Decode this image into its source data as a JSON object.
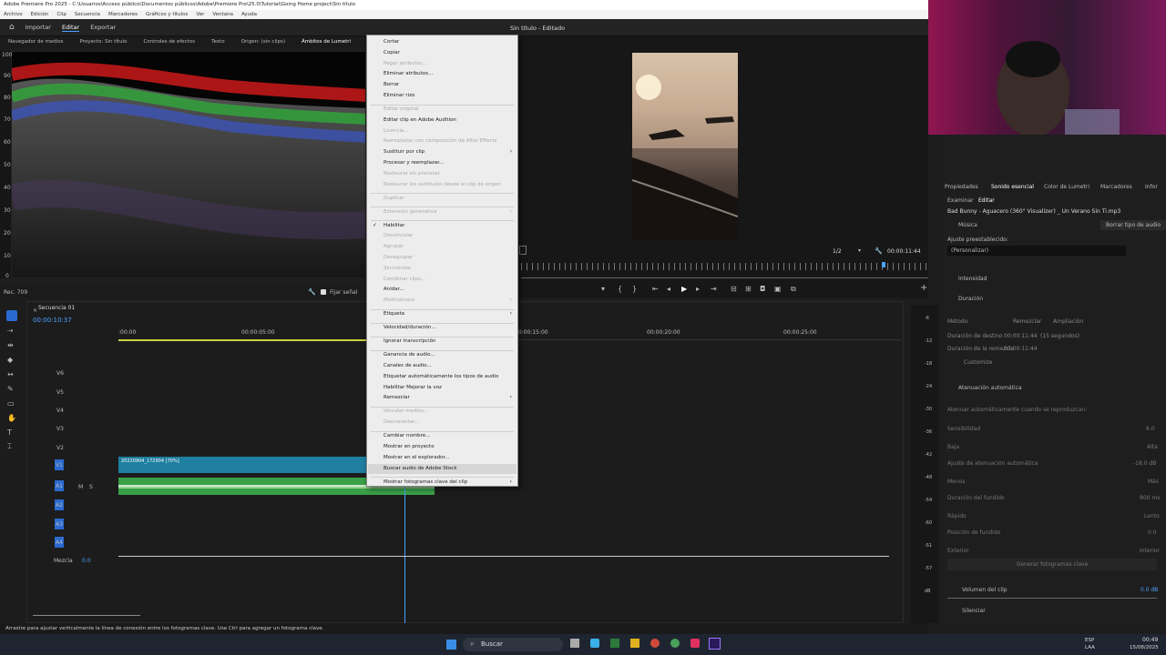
{
  "window": {
    "title": "Adobe Premiere Pro 2025 - C:\\Usuarios\\Acceso público\\Documentos públicos\\Adobe\\Premiere Pro\\25.0\\Tutorial\\Going Home project\\Sin título"
  },
  "menubar": [
    "Archivo",
    "Edición",
    "Clip",
    "Secuencia",
    "Marcadores",
    "Gráficos y títulos",
    "Ver",
    "Ventana",
    "Ayuda"
  ],
  "header": {
    "nav": [
      "Importar",
      "Editar",
      "Exportar"
    ],
    "title": "Sin título - Editado"
  },
  "panel_tabs": [
    "Navegador de medios",
    "Proyecto: Sin título",
    "Controles de efectos",
    "Texto",
    "Origen: (sin clips)",
    "Ámbitos de Lumetri"
  ],
  "scope": {
    "ticks": [
      "100",
      "90",
      "80",
      "70",
      "60",
      "50",
      "40",
      "30",
      "20",
      "10",
      "0"
    ],
    "rec": "Rec. 709",
    "fijar": "Fijar señal"
  },
  "program": {
    "fraction": "1/2",
    "timecode": "00:00:11:44"
  },
  "timeline": {
    "tab": "Secuencia 01",
    "timecode": "00:00:10:37",
    "ruler": [
      ":00:00",
      "00:00:05:00",
      "00:00:15:00",
      "00:00:20:00",
      "00:00:25:00"
    ],
    "video_tracks": [
      "V6",
      "V5",
      "V4",
      "V3",
      "V2",
      "V1"
    ],
    "audio_tracks": [
      "A1",
      "A2",
      "A3",
      "A4"
    ],
    "clip_label": "20220904_172904 [70%]",
    "mix_label": "Mezcla",
    "mix_value": "0.0",
    "track_btns": [
      "M",
      "S"
    ]
  },
  "meter_ticks": [
    "-6",
    "-12",
    "-18",
    "-24",
    "-30",
    "-36",
    "-42",
    "-48",
    "-54",
    "-60",
    "-51",
    "-57",
    "dB"
  ],
  "context_menu": [
    {
      "label": "Cortar",
      "enabled": true
    },
    {
      "label": "Copiar",
      "enabled": true
    },
    {
      "label": "Pegar atributos...",
      "enabled": false
    },
    {
      "label": "Eliminar atributos...",
      "enabled": true
    },
    {
      "label": "Borrar",
      "enabled": true
    },
    {
      "label": "Eliminar rizo",
      "enabled": true
    },
    {
      "sep": true
    },
    {
      "label": "Editar original",
      "enabled": false
    },
    {
      "label": "Editar clip en Adobe Audition",
      "enabled": true
    },
    {
      "label": "Licencia...",
      "enabled": false
    },
    {
      "label": "Reemplazar con composición de After Effects",
      "enabled": false
    },
    {
      "label": "Sustituir por clip",
      "enabled": true,
      "sub": true
    },
    {
      "label": "Procesar y reemplazar...",
      "enabled": true
    },
    {
      "label": "Restaurar sin procesar",
      "enabled": false
    },
    {
      "label": "Restaurar los subtítulos desde el clip de origen",
      "enabled": false
    },
    {
      "sep": true
    },
    {
      "label": "Duplicar",
      "enabled": false
    },
    {
      "sep": true
    },
    {
      "label": "Extensión generativa",
      "enabled": false,
      "sub": true
    },
    {
      "sep": true
    },
    {
      "label": "Habilitar",
      "enabled": true,
      "checked": true
    },
    {
      "label": "Desvincular",
      "enabled": false
    },
    {
      "label": "Agrupar",
      "enabled": false
    },
    {
      "label": "Desagrupar",
      "enabled": false
    },
    {
      "label": "Sincronizar",
      "enabled": false
    },
    {
      "label": "Combinar clips...",
      "enabled": false
    },
    {
      "label": "Anidar...",
      "enabled": true
    },
    {
      "label": "Multicámara",
      "enabled": false,
      "sub": true
    },
    {
      "sep": true
    },
    {
      "label": "Etiqueta",
      "enabled": true,
      "sub": true
    },
    {
      "sep": true
    },
    {
      "label": "Velocidad/duración...",
      "enabled": true
    },
    {
      "sep": true
    },
    {
      "label": "Ignorar transcripción",
      "enabled": true
    },
    {
      "sep": true
    },
    {
      "label": "Ganancia de audio...",
      "enabled": true
    },
    {
      "label": "Canales de audio...",
      "enabled": true
    },
    {
      "label": "Etiquetar automáticamente los tipos de audio",
      "enabled": true
    },
    {
      "label": "Habilitar Mejorar la voz",
      "enabled": true
    },
    {
      "label": "Remezclar",
      "enabled": true,
      "sub": true
    },
    {
      "sep": true
    },
    {
      "label": "Vincular medios...",
      "enabled": false
    },
    {
      "label": "Desconectar...",
      "enabled": false
    },
    {
      "sep": true
    },
    {
      "label": "Cambiar nombre...",
      "enabled": true
    },
    {
      "label": "Mostrar en proyecto",
      "enabled": true
    },
    {
      "label": "Mostrar en el explorador...",
      "enabled": true
    },
    {
      "label": "Buscar audio de Adobe Stock",
      "enabled": true,
      "hover": true
    },
    {
      "sep": true
    },
    {
      "label": "Mostrar fotogramas clave del clip",
      "enabled": true,
      "sub": true
    }
  ],
  "right_panel": {
    "tabs": [
      "Propiedades",
      "Sonido esencial",
      "Color de Lumetri",
      "Marcadores",
      "Infor"
    ],
    "subtabs": [
      "Examinar",
      "Editar"
    ],
    "clip_name": "Bad Bunny - Aguacero (360° Visualizer) _ Un Verano Sin Ti.mp3",
    "type": "Música",
    "clear_btn": "Borrar tipo de audio",
    "preset_label": "Ajuste preestablecido:",
    "preset_value": "(Personalizar)",
    "intensidad": "Intensidad",
    "duracion": "Duración",
    "metodo": "Método",
    "remezclar": "Remezclar",
    "ampliacion": "Ampliación",
    "dur_destino": "Duración de destino",
    "dur_destino_val": "00:00:11:44",
    "dur_destino_sec": "(15 segundos)",
    "dur_remezcla": "Duración de la remezcla",
    "dur_remezcla_val": "00:00:11:44",
    "customize": "Customize",
    "atenuacion": "Atenuación automática",
    "atenuar": "Atenuar automáticamente cuando se reproduzcan:",
    "sensibilidad": "Sensibilidad",
    "sens_val": "6.0",
    "baja": "Baja",
    "alta": "Alta",
    "ajuste_aten": "Ajuste de atenuación automática",
    "ajuste_val": "-18.0 dB",
    "menos": "Menos",
    "mas": "Más",
    "dur_fundido": "Duración del fundido",
    "dur_fundido_val": "800 ms",
    "rapido": "Rápido",
    "lento": "Lento",
    "posicion": "Posición de fundido",
    "pos_val": "0.0",
    "exterior": "Exterior",
    "interior": "Interior",
    "generar": "Generar fotogramas clave",
    "volumen": "Volumen del clip",
    "vol_val": "0.0 dB",
    "silenciar": "Silenciar"
  },
  "status_text": "Arrastre para ajustar verticalmente la línea de conexión entre los fotogramas clave. Use Ctrl para agregar un fotograma clave.",
  "taskbar": {
    "search": "Buscar",
    "lang1": "ESP",
    "lang2": "LAA",
    "time": "00:49",
    "date": "15/08/2025"
  },
  "colors": {
    "accent": "#4aa3ff",
    "clip_video": "#1e7fa0",
    "clip_audio": "#3aa048",
    "menu_bg": "#ededed"
  }
}
